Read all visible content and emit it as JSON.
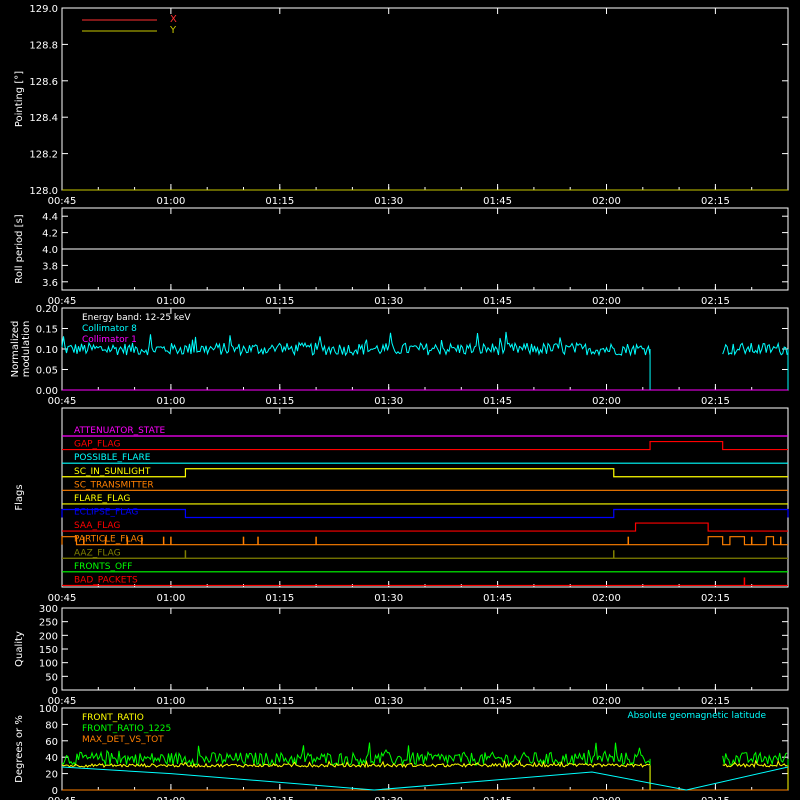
{
  "x_ticks": [
    "00:45",
    "01:00",
    "01:15",
    "01:30",
    "01:45",
    "02:00",
    "02:15"
  ],
  "chart_data": [
    {
      "type": "line",
      "ylabel": "Pointing [°]",
      "ylim": [
        128.0,
        129.0
      ],
      "yticks": [
        "128.0",
        "128.2",
        "128.4",
        "128.6",
        "128.8",
        "129.0"
      ],
      "legend": [
        {
          "name": "X",
          "color": "#ff3030"
        },
        {
          "name": "Y",
          "color": "#c8c800"
        }
      ],
      "series": [
        {
          "name": "X",
          "color": "#ff3030",
          "x": [
            "00:45",
            "02:25"
          ],
          "values": [
            128.0,
            128.0
          ]
        },
        {
          "name": "Y",
          "color": "#c8c800",
          "x": [
            "00:45",
            "02:25"
          ],
          "values": [
            128.0,
            128.0
          ]
        }
      ]
    },
    {
      "type": "line",
      "ylabel": "Roll period [s]",
      "ylim": [
        3.5,
        4.5
      ],
      "yticks": [
        "3.6",
        "3.8",
        "4.0",
        "4.2",
        "4.4"
      ],
      "series": [
        {
          "color": "#ffffff",
          "x": [
            "00:45",
            "02:25"
          ],
          "values": [
            4.0,
            4.0
          ]
        }
      ]
    },
    {
      "type": "line",
      "ylabel": "Normalized modulation",
      "ylim": [
        0.0,
        0.2
      ],
      "yticks": [
        "0.00",
        "0.05",
        "0.10",
        "0.15",
        "0.20"
      ],
      "legend": [
        {
          "name": "Energy band: 12-25 keV",
          "color": "#ffffff"
        },
        {
          "name": "Collimator 8",
          "color": "#00ffff"
        },
        {
          "name": "Collimator 1",
          "color": "#ff00ff"
        }
      ],
      "series": [
        {
          "name": "Collimator 8",
          "color": "#00ffff",
          "segments": [
            [
              "00:45",
              "02:06"
            ],
            [
              "02:16",
              "02:25"
            ]
          ],
          "mean": 0.1,
          "noise": 0.015
        },
        {
          "name": "Collimator 1",
          "color": "#ff00ff",
          "x": [
            "00:45",
            "02:25"
          ],
          "values": [
            0.0,
            0.0
          ]
        }
      ]
    },
    {
      "type": "step",
      "ylabel": "Flags",
      "flags": [
        {
          "name": "ATTENUATOR_STATE",
          "color": "#ff00ff",
          "on": []
        },
        {
          "name": "GAP_FLAG",
          "color": "#ff0000",
          "on": [
            [
              "02:06",
              "02:16"
            ]
          ]
        },
        {
          "name": "POSSIBLE_FLARE",
          "color": "#00ffff",
          "on": []
        },
        {
          "name": "SC_IN_SUNLIGHT",
          "color": "#ffff00",
          "on": [
            [
              "01:02",
              "02:01"
            ]
          ]
        },
        {
          "name": "SC_TRANSMITTER",
          "color": "#ff7f00",
          "on": []
        },
        {
          "name": "FLARE_FLAG",
          "color": "#ffff00",
          "on": []
        },
        {
          "name": "ECLIPSE_FLAG",
          "color": "#0000ff",
          "on": [
            [
              "00:45",
              "01:02"
            ],
            [
              "02:01",
              "02:25"
            ]
          ]
        },
        {
          "name": "SAA_FLAG",
          "color": "#ff0000",
          "on": [
            [
              "02:04",
              "02:14"
            ]
          ]
        },
        {
          "name": "PARTICLE_FLAG",
          "color": "#ff7f00",
          "on": [
            [
              "00:45",
              "00:47"
            ],
            [
              "02:14",
              "02:16"
            ],
            [
              "02:17",
              "02:19"
            ],
            [
              "02:22",
              "02:23"
            ]
          ],
          "spikes": [
            "00:48",
            "00:51",
            "00:54",
            "00:56",
            "00:59",
            "01:00",
            "01:10",
            "01:12",
            "01:20",
            "02:03",
            "02:20",
            "02:24"
          ]
        },
        {
          "name": "AAZ_FLAG",
          "color": "#808000",
          "on": [],
          "spikes": [
            "01:02",
            "02:01"
          ]
        },
        {
          "name": "FRONTS_OFF",
          "color": "#00ff00",
          "on": []
        },
        {
          "name": "BAD_PACKETS",
          "color": "#ff0000",
          "on": [],
          "spikes": [
            "02:19"
          ]
        }
      ]
    },
    {
      "type": "line",
      "ylabel": "Quality",
      "ylim": [
        0,
        300
      ],
      "yticks": [
        "0",
        "50",
        "100",
        "150",
        "200",
        "250",
        "300"
      ],
      "series": []
    },
    {
      "type": "line",
      "ylabel": "Degrees or %",
      "ylim": [
        0,
        100
      ],
      "yticks": [
        "0",
        "20",
        "40",
        "60",
        "80",
        "100"
      ],
      "legend": [
        {
          "name": "FRONT_RATIO",
          "color": "#ffff00"
        },
        {
          "name": "FRONT_RATIO_1225",
          "color": "#00ff00"
        },
        {
          "name": "MAX_DET_VS_TOT",
          "color": "#ff7f00"
        }
      ],
      "annotation": {
        "text": "Absolute geomagnetic latitude",
        "color": "#00ffff"
      },
      "series": [
        {
          "name": "FRONT_RATIO_1225",
          "color": "#00ff00",
          "segments": [
            [
              "00:45",
              "02:06"
            ],
            [
              "02:16",
              "02:25"
            ]
          ],
          "mean": 38,
          "noise": 8
        },
        {
          "name": "FRONT_RATIO",
          "color": "#ffff00",
          "segments": [
            [
              "00:45",
              "02:06"
            ],
            [
              "02:16",
              "02:25"
            ]
          ],
          "mean": 30,
          "noise": 2
        },
        {
          "name": "MAX_DET_VS_TOT",
          "color": "#ff7f00",
          "x": [
            "00:45",
            "02:25"
          ],
          "values": [
            0,
            0
          ]
        },
        {
          "name": "Absolute geomagnetic latitude",
          "color": "#00ffff",
          "x": [
            "00:45",
            "01:00",
            "01:28",
            "01:58",
            "02:11",
            "02:25"
          ],
          "values": [
            28,
            20,
            0,
            22,
            0,
            28
          ]
        }
      ]
    }
  ]
}
